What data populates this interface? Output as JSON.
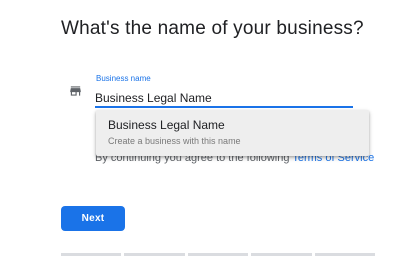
{
  "page": {
    "title": "What's the name of your business?"
  },
  "form": {
    "icon": "store-icon",
    "label": "Business name",
    "value": "Business Legal Name"
  },
  "suggestion": {
    "title": "Business Legal Name",
    "subtitle": "Create a business with this name"
  },
  "terms": {
    "text_before": "By continuing you agree to the following ",
    "link": "Terms of Service"
  },
  "next_label": "Next",
  "progress": {
    "steps": 5
  },
  "colors": {
    "accent": "#1a73e8",
    "text": "#202124",
    "muted": "#5f6368",
    "track": "#dadce0"
  }
}
